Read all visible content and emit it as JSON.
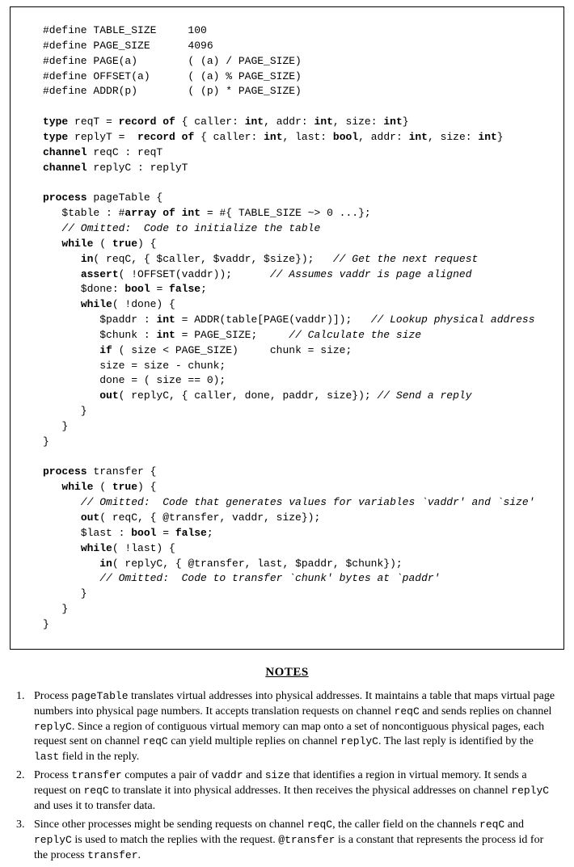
{
  "code": {
    "d1": "#define TABLE_SIZE     100",
    "d2": "#define PAGE_SIZE      4096",
    "d3": "#define PAGE(a)        ( (a) / PAGE_SIZE)",
    "d4": "#define OFFSET(a)      ( (a) % PAGE_SIZE)",
    "d5": "#define ADDR(p)        ( (p) * PAGE_SIZE)",
    "kw_type": "type",
    "kw_record_of": "record of",
    "kw_int": "int",
    "kw_bool": "bool",
    "kw_channel": "channel",
    "kw_process": "process",
    "kw_arrayofint": "array of int",
    "kw_while": "while",
    "kw_true": "true",
    "kw_false": "false",
    "kw_in": "in",
    "kw_out": "out",
    "kw_assert": "assert",
    "kw_if": "if",
    "r1a": " reqT = ",
    "r1b": " { caller: ",
    "r1c": ", addr: ",
    "r1d": ", size: ",
    "r1e": "}",
    "r2a": " replyT =  ",
    "r2b": " { caller: ",
    "r2c": ", last: ",
    "r2d": ", addr: ",
    "r2e": ", size: ",
    "r2f": "}",
    "ch1": " reqC : reqT",
    "ch2": " replyC : replyT",
    "p1a": " pageTable {",
    "p1_table_a": "   $table : #",
    "p1_table_b": " = #{ TABLE_SIZE ~> 0 ...};",
    "p1_omit": "   // Omitted:  Code to initialize the table",
    "p1_while_a": "   ",
    "p1_while_b": " ( ",
    "p1_while_c": ") {",
    "p1_in_a": "      ",
    "p1_in_b": "( reqC, { $caller, $vaddr, $size});   ",
    "p1_in_c": "// Get the next request",
    "p1_assert_a": "      ",
    "p1_assert_b": "( !OFFSET(vaddr));      ",
    "p1_assert_c": "// Assumes vaddr is page aligned",
    "p1_done_a": "      $done: ",
    "p1_done_b": " = ",
    "p1_done_c": ";",
    "p1_while2_a": "      ",
    "p1_while2_b": "( !done) {",
    "p1_paddr_a": "         $paddr : ",
    "p1_paddr_b": " = ADDR(table[PAGE(vaddr)]);   ",
    "p1_paddr_c": "// Lookup physical address",
    "p1_chunk_a": "         $chunk : ",
    "p1_chunk_b": " = PAGE_SIZE;     ",
    "p1_chunk_c": "// Calculate the size",
    "p1_if_a": "         ",
    "p1_if_b": " ( size < PAGE_SIZE)     chunk = size;",
    "p1_sz": "         size = size - chunk;",
    "p1_dn": "         done = ( size == 0);",
    "p1_out_a": "         ",
    "p1_out_b": "( replyC, { caller, done, paddr, size}); ",
    "p1_out_c": "// Send a reply",
    "close1": "      }",
    "close2": "   }",
    "close3": "}",
    "p2a": " transfer {",
    "p2_while_a": "   ",
    "p2_while_b": " ( ",
    "p2_while_c": ") {",
    "p2_omit1": "      // Omitted:  Code that generates values for variables `vaddr' and `size'",
    "p2_out_a": "      ",
    "p2_out_b": "( reqC, { @transfer, vaddr, size});",
    "p2_last_a": "      $last : ",
    "p2_last_b": " = ",
    "p2_last_c": ";",
    "p2_while2_a": "      ",
    "p2_while2_b": "( !last) {",
    "p2_in_a": "         ",
    "p2_in_b": "( replyC, { @transfer, last, $paddr, $chunk});",
    "p2_omit2": "         // Omitted:  Code to transfer `chunk' bytes at `paddr'"
  },
  "notes_heading": "NOTES",
  "notes": {
    "n1": {
      "num": "1.",
      "pre": "Process ",
      "t1": "pageTable",
      "mid1": " translates virtual addresses into physical addresses.  It maintains a table that maps virtual page numbers into physical page numbers. It accepts translation requests on channel ",
      "t2": "reqC",
      "mid2": " and sends replies on channel ",
      "t3": "replyC",
      "mid3": ". Since a region of contiguous virtual memory can map onto a set of noncontiguous physical pages, each request sent on channel ",
      "t4": "reqC",
      "mid4": " can yield multiple replies on channel ",
      "t5": "replyC",
      "mid5": ". The last reply is identified by the ",
      "t6": "last",
      "mid6": " field in the reply."
    },
    "n2": {
      "num": "2.",
      "pre": "Process ",
      "t1": "transfer",
      "mid1": " computes a pair of ",
      "t2": "vaddr",
      "mid2": " and ",
      "t3": "size",
      "mid3": " that identifies a region in virtual memory. It sends a request on ",
      "t4": "reqC",
      "mid4": " to translate it into physical addresses. It then receives the physical addresses on channel ",
      "t5": "replyC",
      "mid5": " and uses it to transfer data."
    },
    "n3": {
      "num": "3.",
      "pre": "Since other processes might be sending requests on channel ",
      "t1": "reqC",
      "mid1": ", the caller field on the channels ",
      "t2": "reqC",
      "mid2": " and ",
      "t3": "replyC",
      "mid3": " is used to match the replies with the request. ",
      "t4": "@transfer",
      "mid4": " is a constant that represents the process id for the process ",
      "t5": "transfer",
      "mid5": "."
    }
  }
}
